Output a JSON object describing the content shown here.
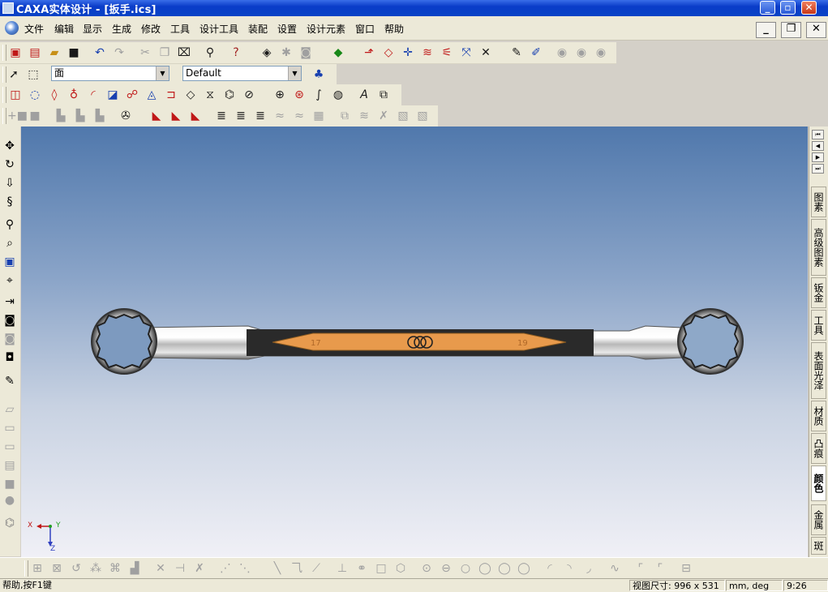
{
  "window": {
    "title": "CAXA实体设计 - [扳手.ics]",
    "buttons": {
      "minimize": "_",
      "restore": "▫",
      "close": "✕"
    }
  },
  "menubar": {
    "items": [
      "文件",
      "编辑",
      "显示",
      "生成",
      "修改",
      "工具",
      "设计工具",
      "装配",
      "设置",
      "设计元素",
      "窗口",
      "帮助"
    ],
    "mdi_buttons": {
      "minimize": "_",
      "restore": "❐",
      "close": "✕"
    }
  },
  "toolbar2": {
    "select_filter": "面",
    "style_combo": "Default"
  },
  "right_tabs": {
    "items": [
      "图素",
      "高级图素",
      "钣金",
      "工具",
      "表面光泽",
      "材质",
      "凸痕",
      "颜色",
      "金属",
      "斑"
    ],
    "active": "颜色"
  },
  "viewport": {
    "axis_labels": {
      "x": "X",
      "y": "Y",
      "z": "Z"
    },
    "wrench_labels": {
      "left": "17",
      "right": "19"
    },
    "colors": {
      "sky_top": "#5078ac",
      "sky_bottom": "#f0f0f6",
      "handle": "#e89a4c"
    }
  },
  "statusbar": {
    "help": "帮助,按F1键",
    "view_size": "视图尺寸: 996 x 531",
    "units": "mm, deg",
    "time": "9:26"
  }
}
